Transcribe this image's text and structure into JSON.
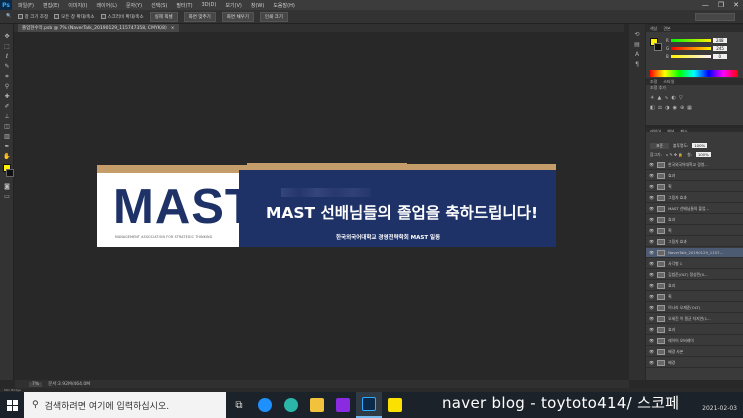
{
  "menubar": {
    "logo": "Ps",
    "items": [
      "파일(F)",
      "편집(E)",
      "이미지(I)",
      "레이어(L)",
      "문자(Y)",
      "선택(S)",
      "필터(T)",
      "3D(D)",
      "보기(V)",
      "창(W)",
      "도움말(H)"
    ],
    "window_buttons": [
      "—",
      "❐",
      "✕"
    ]
  },
  "options": {
    "tool_icon": "🔍",
    "checks": [
      "창 크기 조정",
      "모든 창 확대/축소",
      "스크러비 확대/축소"
    ],
    "buttons": [
      "실제 픽셀",
      "화면 맞추기",
      "화면 채우기",
      "인쇄 크기"
    ]
  },
  "tab": {
    "label": "졸업현수막.psb @ 7% (NaverTalk_20190129_115747358, CMYK/8)",
    "close": "×"
  },
  "banner": {
    "logo_text": "MAST",
    "logo_sub": "MANAGEMENT ASSOCIATION FOR STRATEGIC THINKING",
    "headline": "MAST 선배님들의 졸업을 축하드립니다!",
    "subline": "한국외국어대학교 경영전략학회 MAST 일동",
    "colors": {
      "navy": "#1e3268",
      "gold": "#c59d6a",
      "white": "#ffffff"
    }
  },
  "color_panel": {
    "tabs": [
      "색상",
      "견본"
    ],
    "sliders": [
      {
        "label": "R",
        "value": "248"
      },
      {
        "label": "G",
        "value": "245"
      },
      {
        "label": "B",
        "value": "0"
      }
    ]
  },
  "adjust_panel": {
    "tabs": [
      "조정",
      "스타일"
    ],
    "title": "조정 추가"
  },
  "layers_panel": {
    "tabs": [
      "레이어",
      "채널",
      "패스"
    ],
    "blend": "표준",
    "opacity_label": "불투명도:",
    "opacity": "100%",
    "fill_label": "칠:",
    "fill": "100%",
    "lock_label": "잠그기:",
    "rows": [
      "한국외국어대학교 경영...",
      "효과",
      "획",
      "그림자 효과",
      "MAST 선배님들의 졸업...",
      "효과",
      "획",
      "그림자 효과",
      "NaverTalk_20190129_1157...",
      "사각형 1",
      "김범준(OLT) 정성민(0...",
      "효과",
      "획",
      "이나라 오재준(OLT)",
      "오세진 이 필균 차지연(1...",
      "효과",
      "레이어 오버레이",
      "배경 사본",
      "배경"
    ],
    "selected_index": 8
  },
  "status": {
    "zoom": "7%",
    "doc": "문서:3.92M/464.0M",
    "footer": "Mini Bridge"
  },
  "taskbar": {
    "search_placeholder": "검색하려면 여기에 입력하십시오.",
    "watermark": "naver blog - toytoto414/ 스코페",
    "date": "2021-02-03"
  }
}
